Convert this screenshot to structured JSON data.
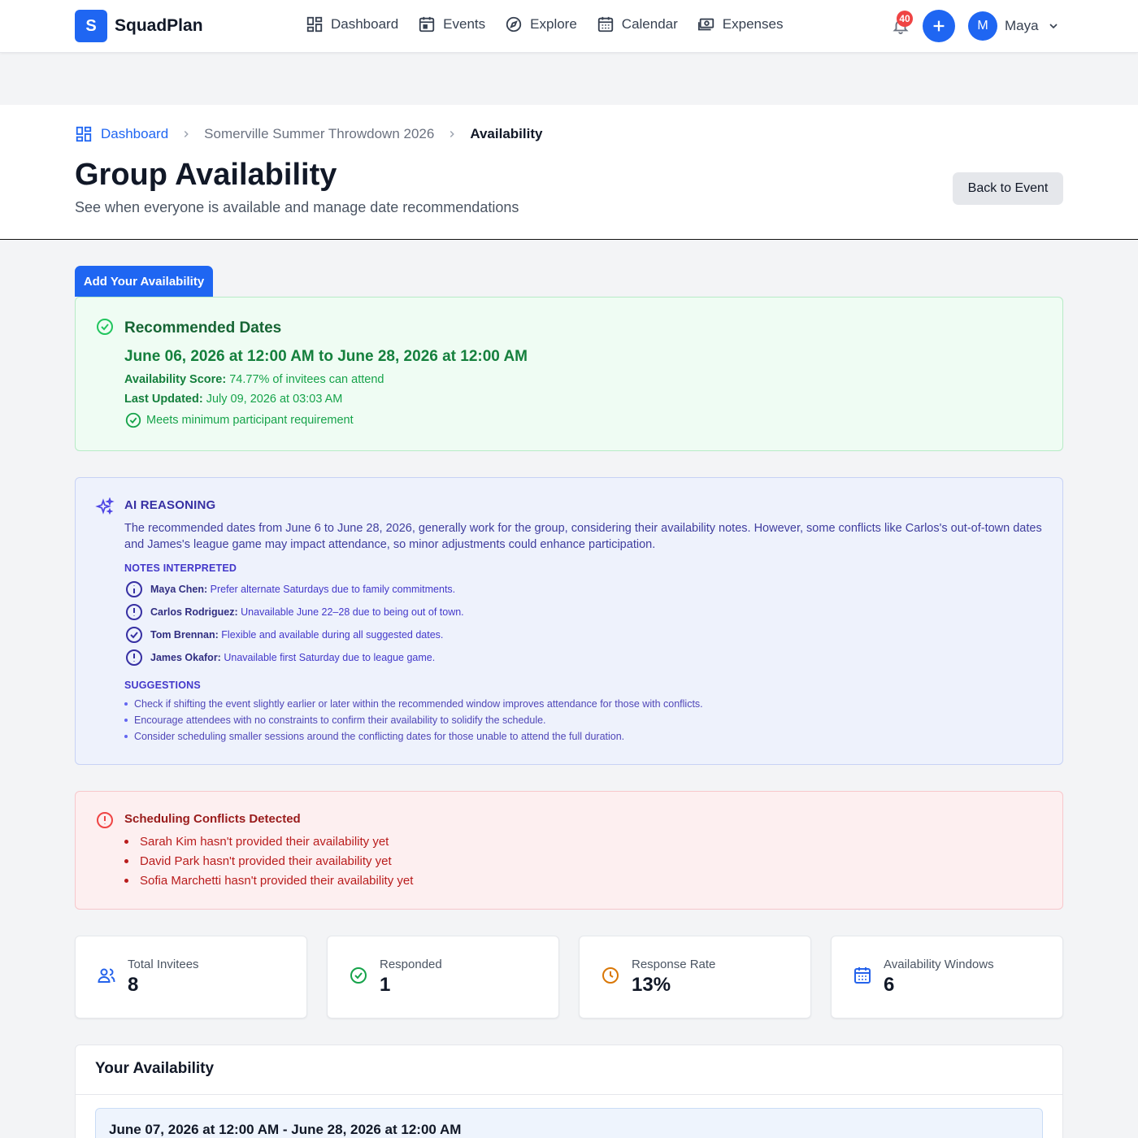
{
  "app": {
    "logo_letter": "S",
    "name": "SquadPlan"
  },
  "nav": [
    {
      "label": "Dashboard",
      "icon": "dashboard-icon"
    },
    {
      "label": "Events",
      "icon": "events-icon"
    },
    {
      "label": "Explore",
      "icon": "compass-icon"
    },
    {
      "label": "Calendar",
      "icon": "calendar-icon"
    },
    {
      "label": "Expenses",
      "icon": "money-icon"
    }
  ],
  "notifications": {
    "count": "40"
  },
  "user": {
    "initial": "M",
    "name": "Maya"
  },
  "breadcrumb": {
    "home": "Dashboard",
    "event": "Somerville Summer Throwdown 2026",
    "current": "Availability"
  },
  "header": {
    "title": "Group Availability",
    "subtitle": "See when everyone is available and manage date recommendations",
    "back_button": "Back to Event"
  },
  "add_button": "Add Your Availability",
  "recommended": {
    "title": "Recommended Dates",
    "dates": "June 06, 2026 at 12:00 AM to June 28, 2026 at 12:00 AM",
    "score_label": "Availability Score:",
    "score_value": "74.77% of invitees can attend",
    "updated_label": "Last Updated:",
    "updated_value": "July 09, 2026 at 03:03 AM",
    "meets": "Meets minimum participant requirement"
  },
  "ai": {
    "title": "AI REASONING",
    "body": "The recommended dates from June 6 to June 28, 2026, generally work for the group, considering their availability notes. However, some conflicts like Carlos's out-of-town dates and James's league game may impact attendance, so minor adjustments could enhance participation.",
    "notes_title": "NOTES INTERPRETED",
    "notes": [
      {
        "name": "Maya Chen:",
        "text": "Prefer alternate Saturdays due to family commitments.",
        "icon": "info-icon"
      },
      {
        "name": "Carlos Rodriguez:",
        "text": "Unavailable June 22–28 due to being out of town.",
        "icon": "alert-icon"
      },
      {
        "name": "Tom Brennan:",
        "text": "Flexible and available during all suggested dates.",
        "icon": "check-circle-icon"
      },
      {
        "name": "James Okafor:",
        "text": "Unavailable first Saturday due to league game.",
        "icon": "alert-icon"
      }
    ],
    "suggestions_title": "SUGGESTIONS",
    "suggestions": [
      "Check if shifting the event slightly earlier or later within the recommended window improves attendance for those with conflicts.",
      "Encourage attendees with no constraints to confirm their availability to solidify the schedule.",
      "Consider scheduling smaller sessions around the conflicting dates for those unable to attend the full duration."
    ]
  },
  "conflicts": {
    "title": "Scheduling Conflicts Detected",
    "items": [
      "Sarah Kim hasn't provided their availability yet",
      "David Park hasn't provided their availability yet",
      "Sofia Marchetti hasn't provided their availability yet"
    ]
  },
  "stats": [
    {
      "label": "Total Invitees",
      "value": "8",
      "icon": "users-icon",
      "color": "#2563eb"
    },
    {
      "label": "Responded",
      "value": "1",
      "icon": "check-circle-icon",
      "color": "#16a34a"
    },
    {
      "label": "Response Rate",
      "value": "13%",
      "icon": "clock-icon",
      "color": "#d97706"
    },
    {
      "label": "Availability Windows",
      "value": "6",
      "icon": "calendar-icon",
      "color": "#2563eb"
    }
  ],
  "your_availability": {
    "title": "Your Availability",
    "first_range": "June 07, 2026 at 12:00 AM - June 28, 2026 at 12:00 AM"
  },
  "colors": {
    "primary": "#1f66f2",
    "success": "#16a34a",
    "ai": "#4338ca",
    "danger": "#b91c1c"
  }
}
